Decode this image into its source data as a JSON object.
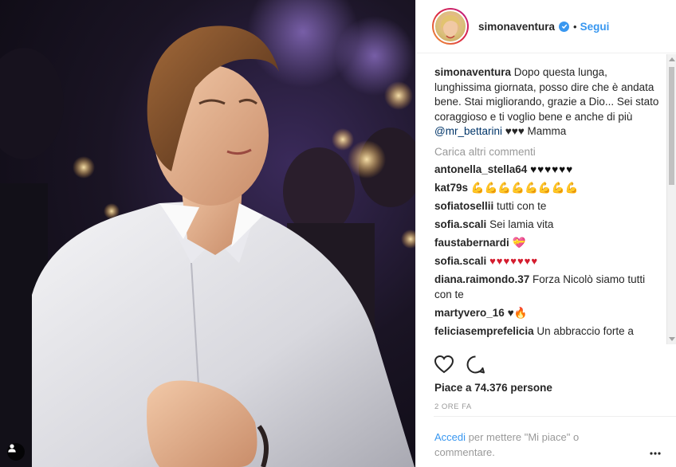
{
  "post": {
    "username": "simonaventura",
    "follow_label": "Segui",
    "separator": "•",
    "caption": "Dopo questa lunga, lunghissima giornata, posso dire che è andata bene. Stai migliorando, grazie a Dio... Sei stato coraggioso e ti voglio bene e anche di più",
    "caption_mention": "@mr_bettarini",
    "caption_end": "♥♥♥ Mamma",
    "load_more": "Carica altri commenti",
    "likes": "Piace a 74.376 persone",
    "time": "2 ORE FA",
    "login_link": "Accedi",
    "login_text": "per mettere \"Mi piace\" o commentare."
  },
  "comments": [
    {
      "user": "antonella_stella64",
      "text": "♥♥♥♥♥♥",
      "kind": "black-hearts"
    },
    {
      "user": "kat79s",
      "text": "💪💪💪💪💪💪💪💪",
      "kind": "emoji"
    },
    {
      "user": "sofiatosellii",
      "text": "tutti con te",
      "kind": "text"
    },
    {
      "user": "sofia.scali",
      "text": "Sei lamia vita",
      "kind": "text"
    },
    {
      "user": "faustabernardi",
      "text": "💝",
      "kind": "emoji"
    },
    {
      "user": "sofia.scali",
      "text": "♥♥♥♥♥♥♥",
      "kind": "hearts"
    },
    {
      "user": "diana.raimondo.37",
      "text": "Forza Nicolò siamo tutti con te",
      "kind": "text"
    },
    {
      "user": "martyvero_16",
      "text": "♥🔥",
      "kind": "emoji"
    },
    {
      "user": "feliciasemprefelicia",
      "text": "Un abbraccio forte a",
      "kind": "text"
    }
  ],
  "icons": {
    "verified": "verified-badge-icon",
    "like": "heart-outline-icon",
    "comment": "comment-bubble-icon",
    "more": "more-options-icon",
    "user_tag": "user-tag-icon"
  },
  "colors": {
    "accent": "#3897f0",
    "text": "#262626",
    "muted": "#999999",
    "mention": "#003569"
  }
}
